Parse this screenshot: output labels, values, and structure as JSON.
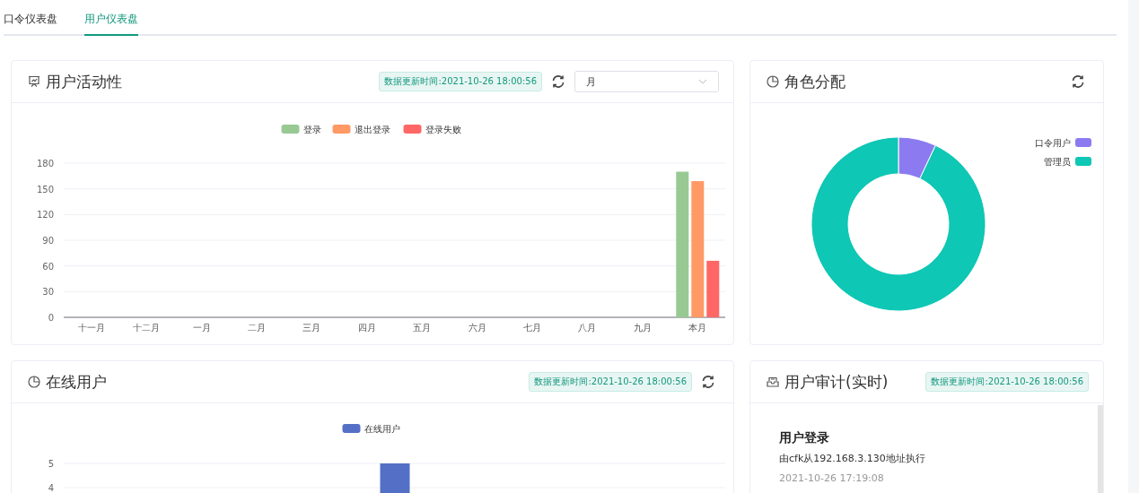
{
  "tabs": [
    {
      "label": "口令仪表盘",
      "selected": false
    },
    {
      "label": "用户仪表盘",
      "selected": true
    }
  ],
  "activity": {
    "title": "用户活动性",
    "updated": "数据更新时间:2021-10-26 18:00:56",
    "period": "月",
    "chart_data": {
      "type": "bar",
      "grid": true,
      "legend": true,
      "categories": [
        "十一月",
        "十二月",
        "一月",
        "二月",
        "三月",
        "四月",
        "五月",
        "六月",
        "七月",
        "八月",
        "九月",
        "本月"
      ],
      "yticks": [
        0,
        30,
        60,
        90,
        120,
        150,
        180
      ],
      "ylim": [
        0,
        180
      ],
      "series": [
        {
          "name": "登录",
          "color": "#98c993",
          "values": [
            0,
            0,
            0,
            0,
            0,
            0,
            0,
            0,
            0,
            0,
            0,
            170
          ]
        },
        {
          "name": "退出登录",
          "color": "#ff9966",
          "values": [
            0,
            0,
            0,
            0,
            0,
            0,
            0,
            0,
            0,
            0,
            0,
            159
          ]
        },
        {
          "name": "登录失败",
          "color": "#ff6666",
          "values": [
            0,
            0,
            0,
            0,
            0,
            0,
            0,
            0,
            0,
            0,
            0,
            66
          ]
        }
      ]
    }
  },
  "roles": {
    "title": "角色分配",
    "chart_data": {
      "type": "donut",
      "legend": true,
      "categories": [
        "口令用户",
        "管理员"
      ],
      "values": [
        7,
        93
      ],
      "colors": [
        "#8c7bf0",
        "#0ec7b4"
      ]
    }
  },
  "online": {
    "title": "在线用户",
    "updated": "数据更新时间:2021-10-26 18:00:56",
    "chart_data": {
      "type": "bar",
      "grid": true,
      "legend": true,
      "ylim": [
        0,
        5
      ],
      "yticks": [
        4,
        5
      ],
      "series": [
        {
          "name": "在线用户",
          "color": "#5470c6",
          "values": [
            5
          ]
        }
      ]
    }
  },
  "audit": {
    "title": "用户审计(实时)",
    "updated": "数据更新时间:2021-10-26 18:00:56",
    "entries": [
      {
        "title": "用户登录",
        "detail": "由cfk从192.168.3.130地址执行",
        "time": "2021-10-26 17:19:08"
      }
    ]
  }
}
